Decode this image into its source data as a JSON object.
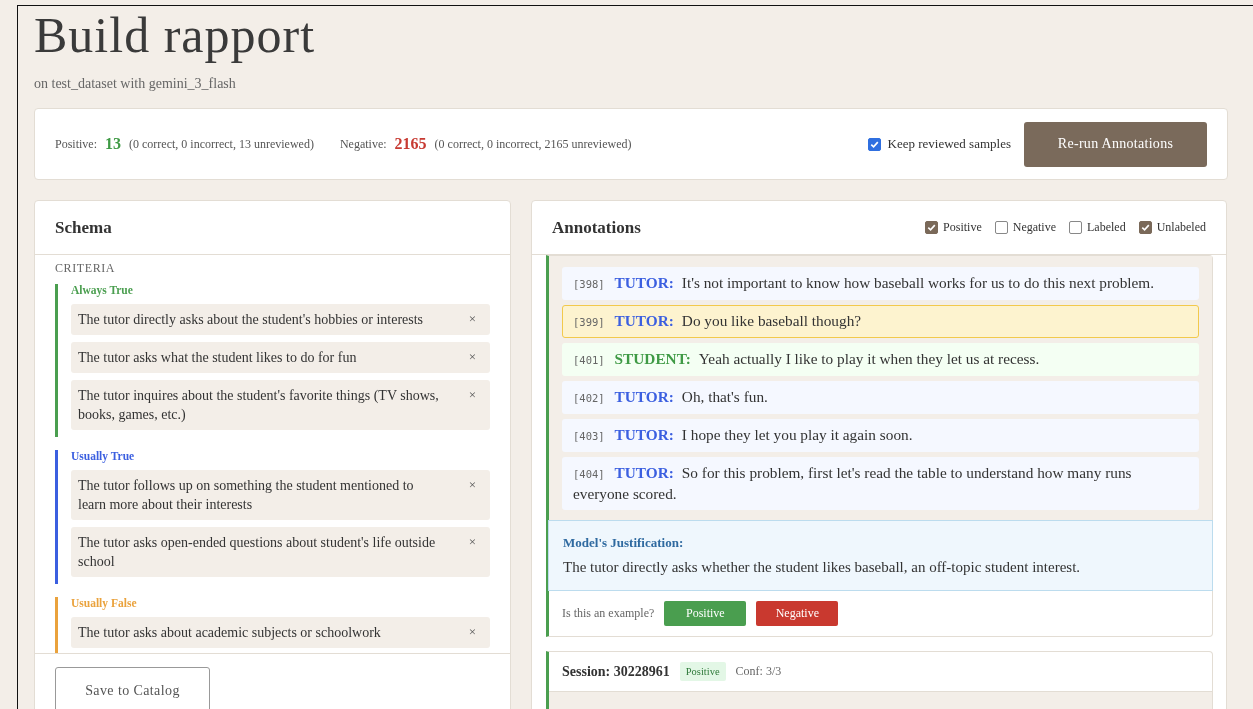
{
  "title": "Build rapport",
  "subtitle": "on test_dataset with gemini_3_flash",
  "stats": [
    {
      "label": "Positive:",
      "count": "13",
      "kind": "positive",
      "detail": "(0 correct, 0 incorrect, 13 unreviewed)"
    },
    {
      "label": "Negative:",
      "count": "2165",
      "kind": "negative",
      "detail": "(0 correct, 0 incorrect, 2165 unreviewed)"
    }
  ],
  "keep_reviewed": {
    "label": "Keep reviewed samples",
    "checked": true
  },
  "rerun_button": "Re-run Annotations",
  "schema": {
    "title": "Schema",
    "section": "CRITERIA",
    "groups": [
      {
        "label": "Always True",
        "color": "#4a9e4f",
        "items": [
          "The tutor directly asks about the student's hobbies or interests",
          "The tutor asks what the student likes to do for fun",
          "The tutor inquires about the student's favorite things (TV shows, books, games, etc.)"
        ]
      },
      {
        "label": "Usually True",
        "color": "#3b5fe0",
        "items": [
          "The tutor follows up on something the student mentioned to learn more about their interests",
          "The tutor asks open-ended questions about student's life outside school"
        ]
      },
      {
        "label": "Usually False",
        "color": "#eaa23c",
        "items": [
          "The tutor asks about academic subjects or schoolwork"
        ]
      }
    ],
    "remove_mark": "×",
    "save_button": "Save to Catalog"
  },
  "annotations": {
    "title": "Annotations",
    "filters": [
      {
        "label": "Positive",
        "checked": true
      },
      {
        "label": "Negative",
        "checked": false
      },
      {
        "label": "Labeled",
        "checked": false
      },
      {
        "label": "Unlabeled",
        "checked": true
      }
    ],
    "messages": [
      {
        "index": "[398]",
        "kind": "tutor",
        "speaker": "TUTOR:",
        "text": "It's not important to know how baseball works for us to do this next problem.",
        "highlighted": false
      },
      {
        "index": "[399]",
        "kind": "tutor",
        "speaker": "TUTOR:",
        "text": "Do you like baseball though?",
        "highlighted": true
      },
      {
        "index": "[401]",
        "kind": "student",
        "speaker": "STUDENT:",
        "text": "Yeah actually I like to play it when they let us at recess.",
        "highlighted": false
      },
      {
        "index": "[402]",
        "kind": "tutor",
        "speaker": "TUTOR:",
        "text": "Oh, that's fun.",
        "highlighted": false
      },
      {
        "index": "[403]",
        "kind": "tutor",
        "speaker": "TUTOR:",
        "text": "I hope they let you play it again soon.",
        "highlighted": false
      },
      {
        "index": "[404]",
        "kind": "tutor",
        "speaker": "TUTOR:",
        "text": "So for this problem, first let's read the table to understand how many runs everyone scored.",
        "highlighted": false
      }
    ],
    "justification": {
      "title": "Model's Justification:",
      "text": "The tutor directly asks whether the student likes baseball, an off-topic student interest."
    },
    "question": "Is this an example?",
    "label_buttons": [
      {
        "label": "Positive",
        "kind": "positive"
      },
      {
        "label": "Negative",
        "kind": "negative"
      }
    ],
    "next_session": {
      "title": "Session: 30228961",
      "badge": "Positive",
      "confidence": "Conf: 3/3"
    }
  }
}
